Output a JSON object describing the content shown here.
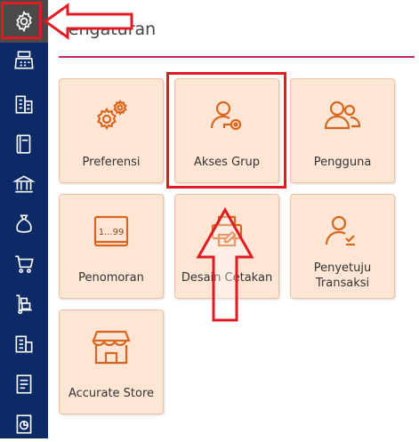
{
  "page": {
    "title": "Pengaturan"
  },
  "sidebar": {
    "items": [
      {
        "icon": "gear-icon"
      },
      {
        "icon": "cash-register-icon"
      },
      {
        "icon": "building-icon"
      },
      {
        "icon": "book-icon"
      },
      {
        "icon": "bank-icon"
      },
      {
        "icon": "money-bag-icon"
      },
      {
        "icon": "cart-icon"
      },
      {
        "icon": "trolley-boxes-icon"
      },
      {
        "icon": "warehouse-icon"
      },
      {
        "icon": "tax-document-icon"
      },
      {
        "icon": "report-chart-icon"
      }
    ]
  },
  "tiles": [
    {
      "label": "Preferensi",
      "icon": "gears-icon"
    },
    {
      "label": "Akses Grup",
      "icon": "user-key-icon"
    },
    {
      "label": "Pengguna",
      "icon": "users-icon"
    },
    {
      "label": "Penomoran",
      "icon": "numbering-icon",
      "icon_text": "1...99"
    },
    {
      "label": "Desain Cetakan",
      "icon": "print-design-icon"
    },
    {
      "label": "Penyetuju\nTransaksi",
      "icon": "user-approve-icon"
    },
    {
      "label": "Accurate Store",
      "icon": "store-icon"
    }
  ],
  "colors": {
    "sidebar_bg": "#0c2a66",
    "tile_bg": "#ffe5d4",
    "icon_orange": "#d9661e",
    "accent_line": "#c8236a",
    "annotation_red": "#e11b22"
  }
}
